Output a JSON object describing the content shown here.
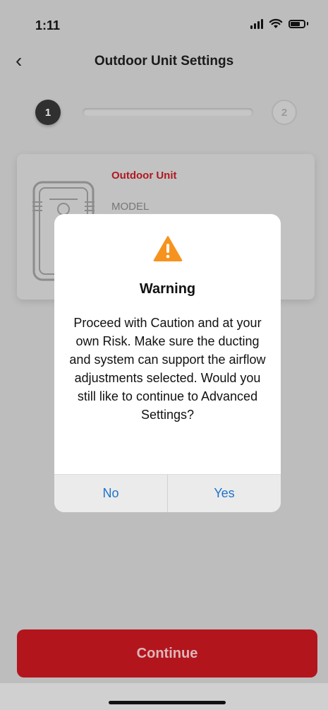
{
  "status_bar": {
    "time": "1:11",
    "icons": [
      "cellular-signal-icon",
      "wifi-icon",
      "battery-icon"
    ]
  },
  "header": {
    "back_icon": "chevron-left-icon",
    "title": "Outdoor Unit Settings"
  },
  "stepper": {
    "steps": [
      "1",
      "2"
    ],
    "current_step": 1
  },
  "card": {
    "title": "Outdoor Unit",
    "label": "MODEL",
    "icon": "outdoor-unit-icon"
  },
  "dialog": {
    "icon": "warning-triangle-icon",
    "title": "Warning",
    "message": "Proceed with Caution and at your own Risk. Make sure the ducting and system can support the airflow adjustments selected. Would you still like to continue to Advanced Settings?",
    "buttons": {
      "no": "No",
      "yes": "Yes"
    }
  },
  "footer": {
    "continue_label": "Continue"
  },
  "colors": {
    "accent_red": "#b3151d",
    "link_blue": "#1e73c9",
    "warning_orange": "#f6931f"
  }
}
